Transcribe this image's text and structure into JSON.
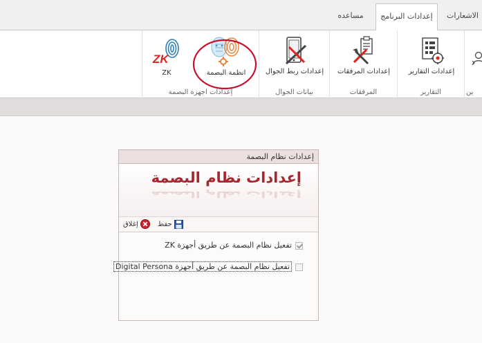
{
  "tabs": [
    {
      "label": "الاشعارات",
      "active": false
    },
    {
      "label": "إعدادات البرنامج",
      "active": true
    },
    {
      "label": "مساعده",
      "active": false
    }
  ],
  "ribbon": {
    "groups": [
      {
        "label": "التقارير",
        "buttons": [
          {
            "label": "إعدادات التقارير",
            "icon": "report-settings-icon"
          }
        ]
      },
      {
        "label": "المرفقات",
        "buttons": [
          {
            "label": "إعدادات المرفقات",
            "icon": "attachments-settings-icon"
          }
        ]
      },
      {
        "label": "بيانات الجوال",
        "buttons": [
          {
            "label": "إعدادات ربط الجوال",
            "icon": "mobile-link-icon"
          }
        ]
      },
      {
        "label": "إعدادات اجهزة البصمة",
        "buttons": [
          {
            "label": "انظمة البصمة",
            "icon": "fingerprint-systems-icon"
          },
          {
            "label": "ZK",
            "icon": "zk-logo-icon"
          }
        ]
      }
    ],
    "edge_label": "ين",
    "zk_logo_text": "ZK"
  },
  "dialog": {
    "title": "إعدادات نظام البصمة",
    "banner": "إعدادات  نظام  البصمة",
    "toolbar": {
      "save_label": "حفظ",
      "close_label": "إغلاق"
    },
    "options": [
      {
        "label": "تفعيل نظام البصمة عن طريق أجهزة ZK",
        "checked": true
      },
      {
        "label": "تفعيل نظام البصمة عن طريق أجهزة Digital Persona",
        "checked": false
      }
    ]
  },
  "colors": {
    "banner_red": "#a8262e",
    "highlight_circle": "#c8102e",
    "zk_red": "#e0231b"
  }
}
